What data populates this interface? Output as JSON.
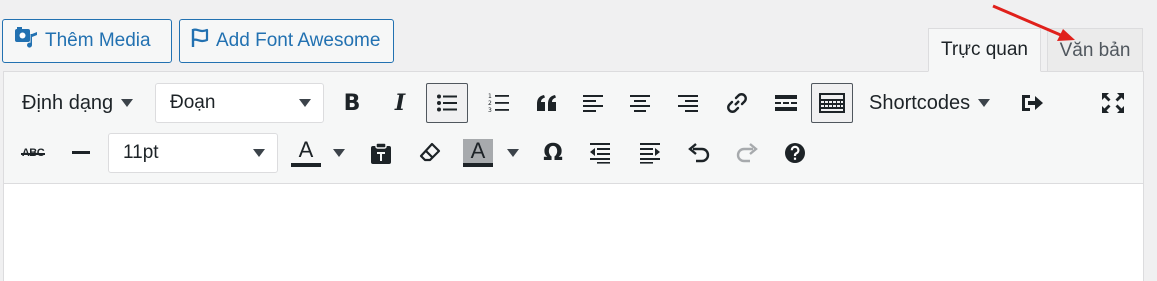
{
  "buttons": {
    "add_media": "Thêm Media",
    "add_font_awesome": "Add Font Awesome"
  },
  "tabs": {
    "visual": "Trực quan",
    "text": "Văn bản"
  },
  "toolbar": {
    "format_dropdown": "Định dạng",
    "paragraph_select": "Đoạn",
    "shortcodes_dropdown": "Shortcodes",
    "font_size_select": "11pt",
    "text_color_letter": "A",
    "background_color_letter": "A",
    "strikethrough_label": "ABC"
  },
  "colors": {
    "accent": "#2271b1",
    "toolbar_bg": "#f6f7f7",
    "arrow": "#e0201b"
  },
  "icons": [
    "media-icon",
    "flag-icon",
    "bold-icon",
    "italic-icon",
    "bullet-list-icon",
    "numbered-list-icon",
    "blockquote-icon",
    "align-left-icon",
    "align-center-icon",
    "align-right-icon",
    "link-icon",
    "read-more-icon",
    "toolbar-toggle-icon",
    "exit-icon",
    "fullscreen-icon",
    "strikethrough-icon",
    "horizontal-line-icon",
    "paste-text-icon",
    "clear-formatting-icon",
    "special-character-icon",
    "outdent-icon",
    "indent-icon",
    "undo-icon",
    "redo-icon",
    "help-icon"
  ]
}
